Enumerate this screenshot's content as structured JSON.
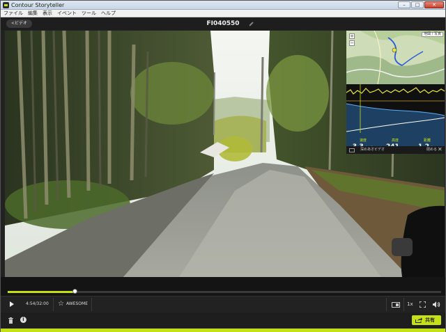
{
  "window": {
    "title": "Contour Storyteller",
    "minimize": "–",
    "maximize": "□",
    "close": "✕"
  },
  "menu": [
    "ファイル",
    "編集",
    "表示",
    "イベント",
    "ツール",
    "ヘルプ"
  ],
  "header": {
    "back_label": "<ビデオ",
    "video_title": "FI040550"
  },
  "map": {
    "type_label": "地図 / 写真",
    "zoom_in": "+",
    "zoom_out": "−"
  },
  "stats": [
    {
      "label": "速度",
      "value": "3.3",
      "unit": "km/h"
    },
    {
      "label": "高度",
      "value": "241",
      "unit": "m"
    },
    {
      "label": "距離",
      "value": "1.2",
      "unit": "km"
    }
  ],
  "overlay_footer": {
    "label": "深めあオビデオ",
    "fold": "閉める",
    "close": "✕"
  },
  "playback": {
    "progress": 0.155,
    "time": "4:54/32:00",
    "rating_label": "AWESOME",
    "speed": "1x"
  },
  "share": {
    "label": "共有"
  },
  "colors": {
    "accent": "#c6e018",
    "panel": "#1e1e1e"
  }
}
